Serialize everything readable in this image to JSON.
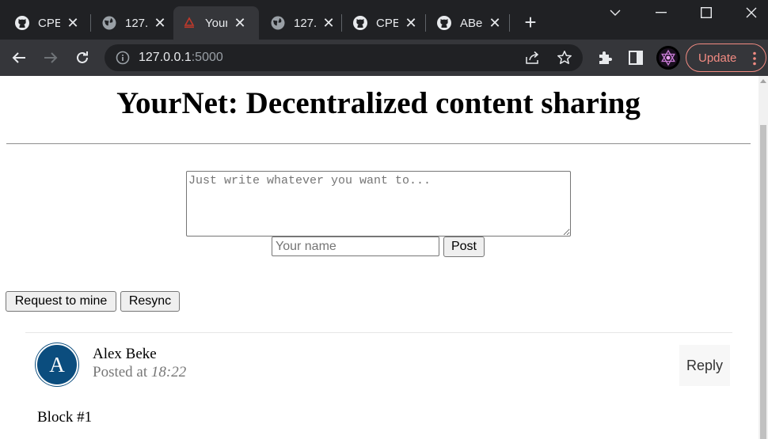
{
  "browser": {
    "tabs": [
      {
        "title": "CPE",
        "icon": "github-icon"
      },
      {
        "title": "127.",
        "icon": "globe-icon"
      },
      {
        "title": "Your",
        "icon": "yournet-favicon",
        "active": true
      },
      {
        "title": "127.",
        "icon": "globe-icon"
      },
      {
        "title": "CPE",
        "icon": "github-icon"
      },
      {
        "title": "ABe",
        "icon": "github-icon"
      }
    ],
    "url_host": "127.0.0.1",
    "url_port": ":5000",
    "update_label": "Update"
  },
  "page": {
    "title": "YourNet: Decentralized content sharing",
    "content_placeholder": "Just write whatever you want to...",
    "name_placeholder": "Your name",
    "post_label": "Post",
    "mine_label": "Request to mine",
    "resync_label": "Resync"
  },
  "posts": [
    {
      "avatar_letter": "A",
      "author": "Alex Beke",
      "posted_prefix": "Posted at",
      "time": "18:22",
      "reply_label": "Reply",
      "content": "Block #1"
    }
  ],
  "colors": {
    "chrome_dark": "#202124",
    "chrome_toolbar": "#35363a",
    "update_accent": "#f28b82",
    "avatar_bg": "#0b4d7e"
  }
}
